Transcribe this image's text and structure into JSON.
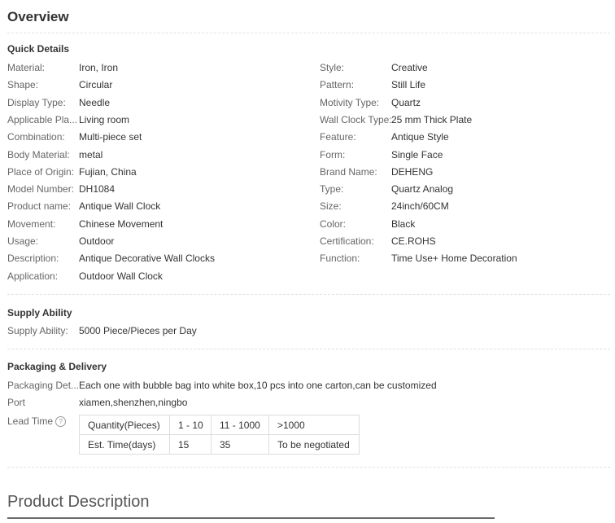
{
  "overview_title": "Overview",
  "quick_details": {
    "title": "Quick Details",
    "left": [
      {
        "k": "Material:",
        "v": "Iron, Iron"
      },
      {
        "k": "Shape:",
        "v": "Circular"
      },
      {
        "k": "Display Type:",
        "v": "Needle"
      },
      {
        "k": "Applicable Pla...",
        "v": "Living room"
      },
      {
        "k": "Combination:",
        "v": "Multi-piece set"
      },
      {
        "k": "Body Material:",
        "v": "metal"
      },
      {
        "k": "Place of Origin:",
        "v": "Fujian, China"
      },
      {
        "k": "Model Number:",
        "v": "DH1084"
      },
      {
        "k": "Product name:",
        "v": "Antique Wall Clock"
      },
      {
        "k": "Movement:",
        "v": "Chinese Movement"
      },
      {
        "k": "Usage:",
        "v": "Outdoor"
      },
      {
        "k": "Description:",
        "v": "Antique Decorative Wall Clocks"
      },
      {
        "k": "Application:",
        "v": "Outdoor Wall Clock"
      }
    ],
    "right": [
      {
        "k": "Style:",
        "v": "Creative"
      },
      {
        "k": "Pattern:",
        "v": "Still Life"
      },
      {
        "k": "Motivity Type:",
        "v": "Quartz"
      },
      {
        "k": "Wall Clock Type:",
        "v": "25 mm Thick Plate"
      },
      {
        "k": "Feature:",
        "v": "Antique Style"
      },
      {
        "k": "Form:",
        "v": "Single Face"
      },
      {
        "k": "Brand Name:",
        "v": "DEHENG"
      },
      {
        "k": "Type:",
        "v": "Quartz Analog"
      },
      {
        "k": "Size:",
        "v": "24inch/60CM"
      },
      {
        "k": "Color:",
        "v": "Black"
      },
      {
        "k": "Certification:",
        "v": "CE.ROHS"
      },
      {
        "k": "Function:",
        "v": "Time Use+ Home Decoration"
      }
    ]
  },
  "supply": {
    "title": "Supply Ability",
    "label": "Supply Ability:",
    "value": "5000 Piece/Pieces per Day"
  },
  "packaging": {
    "title": "Packaging & Delivery",
    "details_label": "Packaging Det...",
    "details_value": "Each one with bubble bag into white box,10 pcs into one carton,can be customized",
    "port_label": "Port",
    "port_value": "xiamen,shenzhen,ningbo",
    "lead_label": "Lead Time",
    "lead_help_icon": "?",
    "lead_table": [
      [
        "Quantity(Pieces)",
        "1 - 10",
        "11 - 1000",
        ">1000"
      ],
      [
        "Est. Time(days)",
        "15",
        "35",
        "To be negotiated"
      ]
    ]
  },
  "product_description_title": "Product Description"
}
